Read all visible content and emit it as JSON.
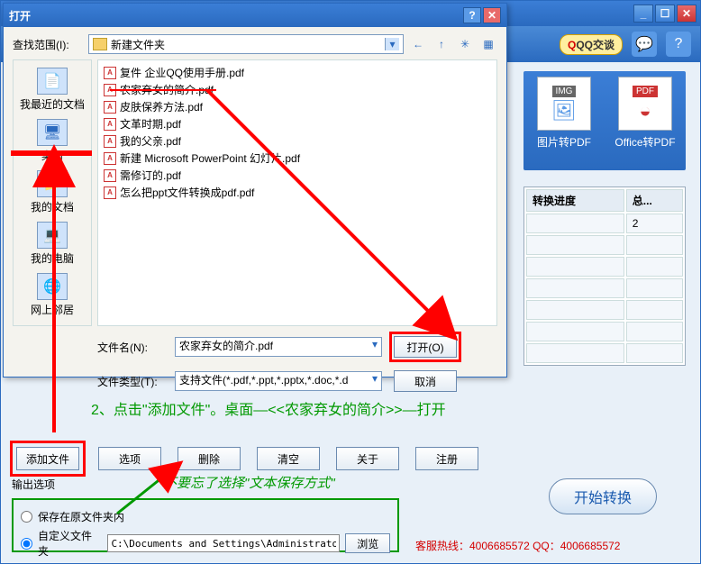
{
  "main": {
    "window_buttons": {
      "min": "_",
      "max": "☐",
      "close": "✕"
    },
    "qq_label": "QQ交谈",
    "toolbar_icons": {
      "chat": "💬",
      "help": "?"
    },
    "conversions": [
      {
        "tag": "IMG",
        "glyph": "🖼",
        "label": "图片转PDF"
      },
      {
        "tag": "PDF",
        "glyph": "◒",
        "label": "Office转PDF"
      }
    ],
    "progress": {
      "col1": "转换进度",
      "col2": "总...",
      "val": "2"
    },
    "instruction": "2、点击\"添加文件\"。桌面—<<农家弃女的简介>>—打开",
    "buttons": {
      "add": "添加文件",
      "opts": "选项",
      "del": "删除",
      "clear": "清空",
      "about": "关于",
      "reg": "注册"
    },
    "output_label": "输出选项",
    "green_note": "不要忘了选择\"文本保存方式\"",
    "radio1": "保存在原文件夹内",
    "radio2": "自定义文件夹",
    "path": "C:\\Documents and Settings\\Administrator\\桌面",
    "browse": "浏览",
    "start": "开始转换",
    "hotline": "客服热线：4006685572 QQ：4006685572"
  },
  "dialog": {
    "title": "打开",
    "help": "?",
    "close": "✕",
    "look_label": "查找范围(I):",
    "look_value": "新建文件夹",
    "dd": "▾",
    "nav": {
      "back": "←",
      "up": "↑",
      "new": "✳",
      "view": "▦"
    },
    "places": [
      {
        "glyph": "📄",
        "label": "我最近的文档"
      },
      {
        "glyph": "🖥",
        "label": "桌面"
      },
      {
        "glyph": "📁",
        "label": "我的文档"
      },
      {
        "glyph": "💻",
        "label": "我的电脑"
      },
      {
        "glyph": "🌐",
        "label": "网上邻居"
      }
    ],
    "files": [
      "复件 企业QQ使用手册.pdf",
      "农家弃女的简介.pdf",
      "皮肤保养方法.pdf",
      "文革时期.pdf",
      "我的父亲.pdf",
      "新建 Microsoft PowerPoint 幻灯片.pdf",
      "需修订的.pdf",
      "怎么把ppt文件转换成pdf.pdf"
    ],
    "filename_label": "文件名(N):",
    "filename_value": "农家弃女的简介.pdf",
    "filetype_label": "文件类型(T):",
    "filetype_value": "支持文件(*.pdf,*.ppt,*.pptx,*.doc,*.d",
    "open_btn": "打开(O)",
    "cancel_btn": "取消"
  }
}
